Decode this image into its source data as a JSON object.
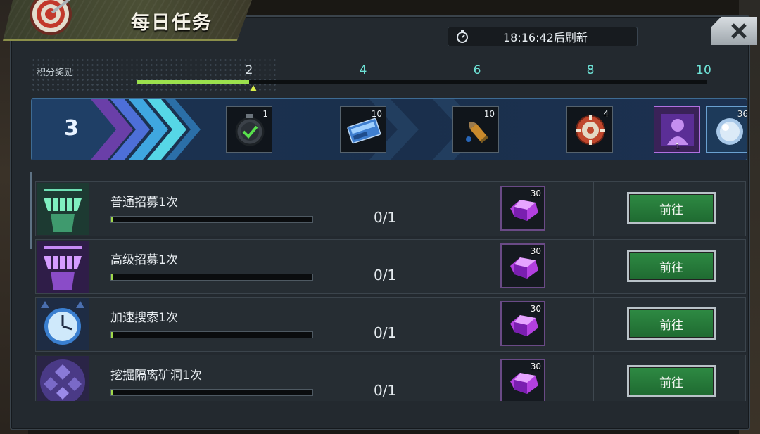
{
  "window": {
    "title": "每日任务",
    "refresh_timer": "18:16:42后刷新",
    "close_label": "close"
  },
  "points": {
    "label": "积分奖励",
    "ticks": [
      "2",
      "4",
      "6",
      "8",
      "10"
    ],
    "current_points": 2,
    "max_points": 10,
    "score_display": "3"
  },
  "rewards": [
    {
      "icon": "stopwatch-check-icon",
      "qty": "1"
    },
    {
      "icon": "cinema-ticket-icon",
      "qty": "10"
    },
    {
      "icon": "bullet-ammo-icon",
      "qty": "10"
    },
    {
      "icon": "poker-chip-icon",
      "qty": "4"
    },
    {
      "icon": "hero-portrait-card-icon",
      "qty": "1"
    },
    {
      "icon": "crystal-orb-icon",
      "qty": "36"
    }
  ],
  "tasks": [
    {
      "name": "普通招募1次",
      "progress": "0/1",
      "progress_value": 0,
      "reward_qty": "30",
      "button": "前往",
      "icon": "green-recruit-pod-icon"
    },
    {
      "name": "高级招募1次",
      "progress": "0/1",
      "progress_value": 0,
      "reward_qty": "30",
      "button": "前往",
      "icon": "purple-recruit-pod-icon"
    },
    {
      "name": "加速搜索1次",
      "progress": "0/1",
      "progress_value": 0,
      "reward_qty": "30",
      "button": "前往",
      "icon": "speedup-clock-icon"
    },
    {
      "name": "挖掘隔离矿洞1次",
      "progress": "0/1",
      "progress_value": 0,
      "reward_qty": "30",
      "button": "前往",
      "icon": "mine-crystal-icon"
    }
  ],
  "colors": {
    "accent_teal": "#6ee3d7",
    "progress_green": "#9be04d",
    "button_green": "#2e8a43",
    "reward_purple": "#6a4a86"
  }
}
